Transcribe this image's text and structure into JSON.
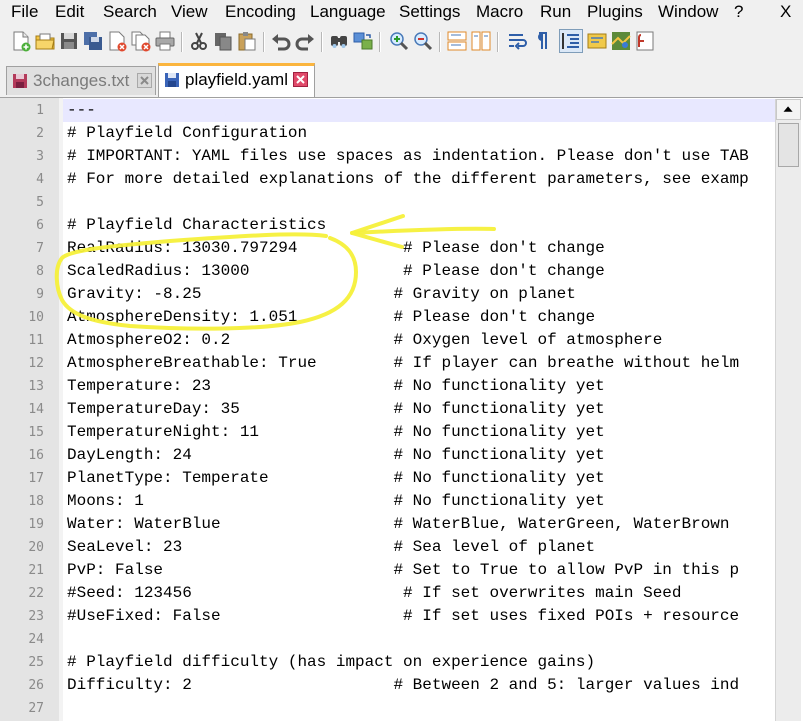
{
  "menu": [
    "File",
    "Edit",
    "Search",
    "View",
    "Encoding",
    "Language",
    "Settings",
    "Macro",
    "Run",
    "Plugins",
    "Window",
    "?"
  ],
  "close_glyph": "X",
  "toolbar_icons": [
    "new-file-icon",
    "open-file-icon",
    "save-icon",
    "save-all-icon",
    "close-icon",
    "close-all-icon",
    "print-icon",
    "cut-icon",
    "copy-icon",
    "paste-icon",
    "undo-icon",
    "redo-icon",
    "find-icon",
    "replace-icon",
    "zoom-in-icon",
    "zoom-out-icon",
    "sync-vertical-icon",
    "sync-horizontal-icon",
    "word-wrap-icon",
    "show-all-characters-icon",
    "indent-guide-icon",
    "user-defined-language-icon",
    "doc-map-icon",
    "function-list-icon"
  ],
  "tabs": [
    {
      "label": "3changes.txt",
      "state": "inactive",
      "modified": true
    },
    {
      "label": "playfield.yaml",
      "state": "active",
      "modified": false
    }
  ],
  "editor": {
    "current_line": 1,
    "lines": [
      {
        "n": "1",
        "text": "---"
      },
      {
        "n": "2",
        "text": "# Playfield Configuration"
      },
      {
        "n": "3",
        "text": "# IMPORTANT: YAML files use spaces as indentation. Please don't use TAB"
      },
      {
        "n": "4",
        "text": "# For more detailed explanations of the different parameters, see examp"
      },
      {
        "n": "5",
        "text": ""
      },
      {
        "n": "6",
        "text": "# Playfield Characteristics"
      },
      {
        "n": "7",
        "text": "RealRadius: 13030.797294           # Please don't change"
      },
      {
        "n": "8",
        "text": "ScaledRadius: 13000                # Please don't change"
      },
      {
        "n": "9",
        "text": "Gravity: -8.25                    # Gravity on planet"
      },
      {
        "n": "10",
        "text": "AtmosphereDensity: 1.051          # Please don't change"
      },
      {
        "n": "11",
        "text": "AtmosphereO2: 0.2                 # Oxygen level of atmosphere"
      },
      {
        "n": "12",
        "text": "AtmosphereBreathable: True        # If player can breathe without helm"
      },
      {
        "n": "13",
        "text": "Temperature: 23                   # No functionality yet"
      },
      {
        "n": "14",
        "text": "TemperatureDay: 35                # No functionality yet"
      },
      {
        "n": "15",
        "text": "TemperatureNight: 11              # No functionality yet"
      },
      {
        "n": "16",
        "text": "DayLength: 24                     # No functionality yet"
      },
      {
        "n": "17",
        "text": "PlanetType: Temperate             # No functionality yet"
      },
      {
        "n": "18",
        "text": "Moons: 1                          # No functionality yet"
      },
      {
        "n": "19",
        "text": "Water: WaterBlue                  # WaterBlue, WaterGreen, WaterBrown"
      },
      {
        "n": "20",
        "text": "SeaLevel: 23                      # Sea level of planet"
      },
      {
        "n": "21",
        "text": "PvP: False                        # Set to True to allow PvP in this p"
      },
      {
        "n": "22",
        "text": "#Seed: 123456                      # If set overwrites main Seed"
      },
      {
        "n": "23",
        "text": "#UseFixed: False                   # If set uses fixed POIs + resource"
      },
      {
        "n": "24",
        "text": ""
      },
      {
        "n": "25",
        "text": "# Playfield difficulty (has impact on experience gains)"
      },
      {
        "n": "26",
        "text": "Difficulty: 2                     # Between 2 and 5: larger values ind"
      },
      {
        "n": "27",
        "text": ""
      }
    ]
  },
  "colors": {
    "gutter_bg": "#e4e4e4",
    "current_line_bg": "#e8e8ff",
    "active_tab_accent": "#fbb53e",
    "annotation": "#f5f03a"
  }
}
